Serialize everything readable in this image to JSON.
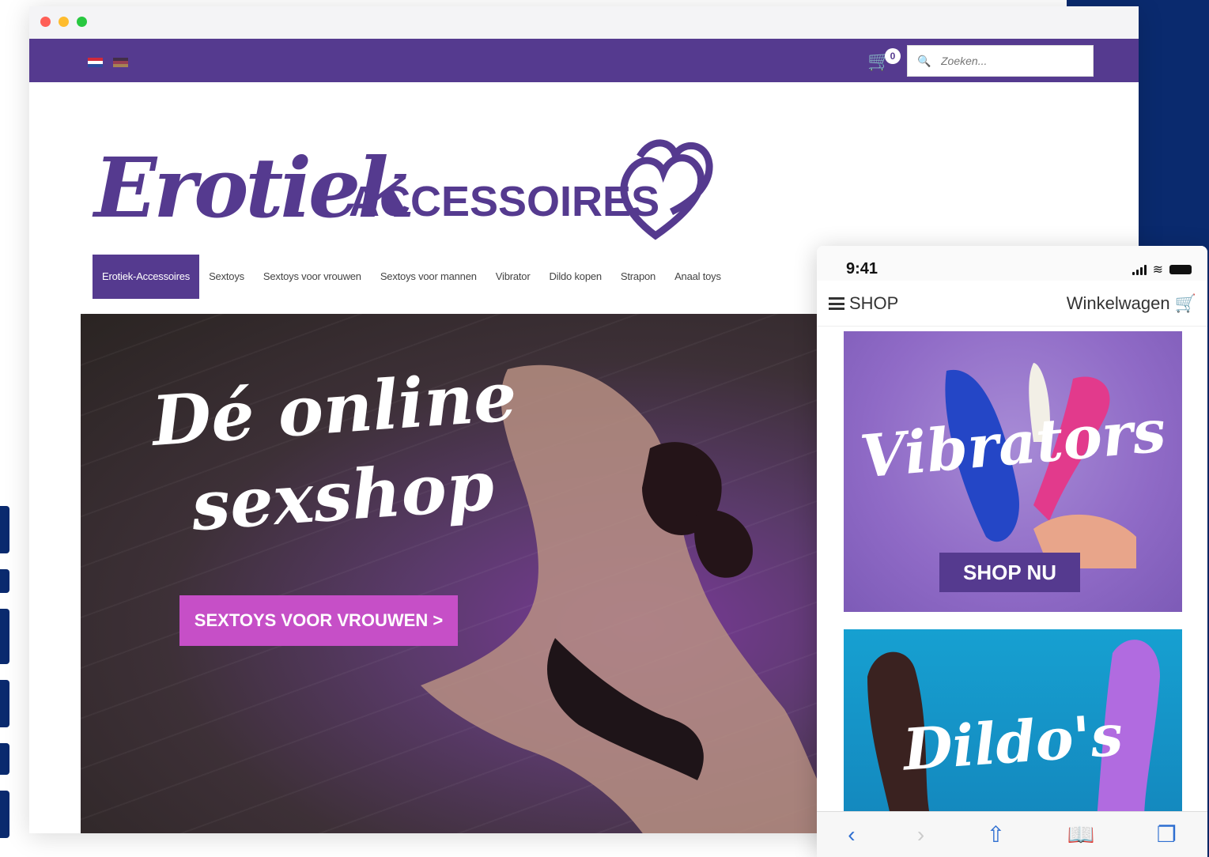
{
  "colors": {
    "brand": "#553a8f",
    "cta": "#c64fc7",
    "backdrop": "#0a2a6e",
    "mobile_link": "#2f6fd1"
  },
  "desktop": {
    "cart": {
      "count": "0",
      "icon": "cart-icon"
    },
    "search": {
      "placeholder": "Zoeken...",
      "icon": "search-icon"
    },
    "logo": {
      "script": "Erotiek",
      "caps": "ACCESSOIRES"
    },
    "nav": [
      "Erotiek-Accessoires",
      "Sextoys",
      "Sextoys voor vrouwen",
      "Sextoys voor mannen",
      "Vibrator",
      "Dildo kopen",
      "Strapon",
      "Anaal toys"
    ],
    "hero": {
      "line1": "Dé online",
      "line2": "sexshop",
      "button": "SEXTOYS VOOR VROUWEN >"
    }
  },
  "mobile": {
    "status_time": "9:41",
    "menu_label": "SHOP",
    "cart_label": "Winkelwagen",
    "cards": [
      {
        "title": "Vibrators",
        "button": "SHOP NU"
      },
      {
        "title": "Dildo's"
      }
    ]
  }
}
